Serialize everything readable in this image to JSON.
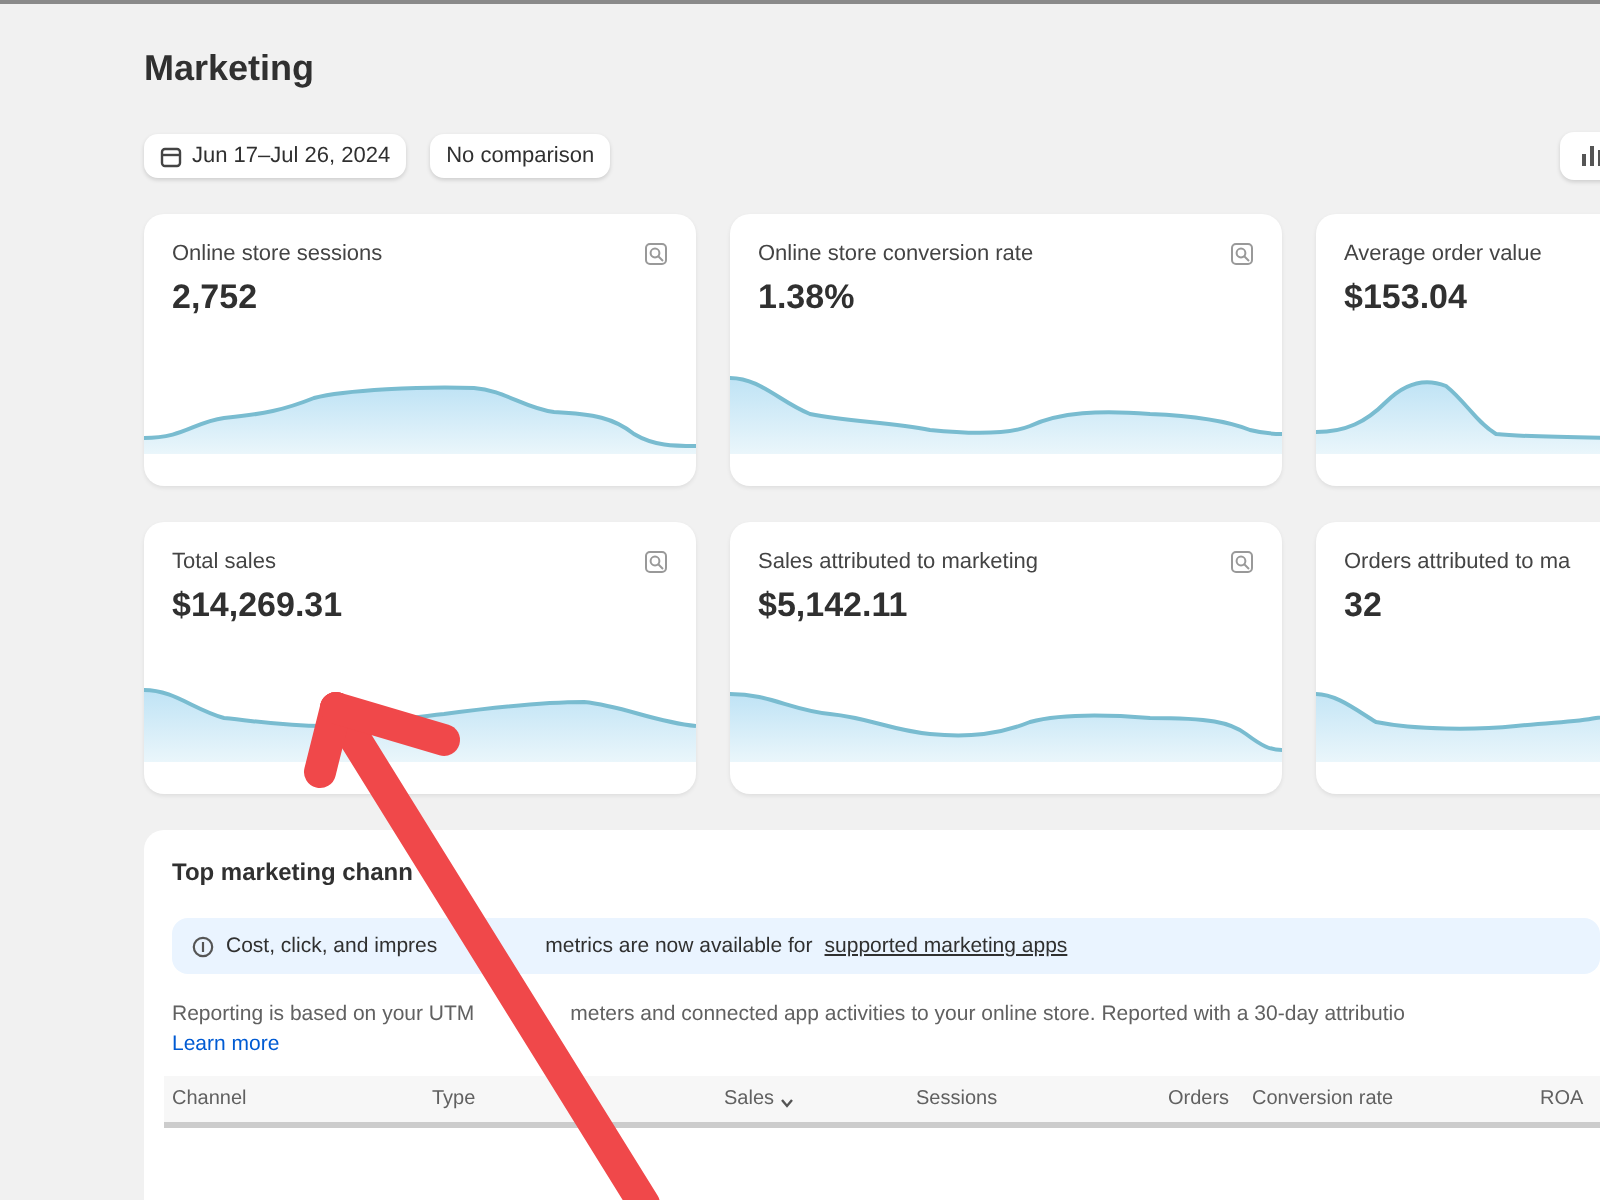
{
  "page": {
    "title": "Marketing"
  },
  "filters": [
    {
      "kind": "date",
      "label": "Jun 17–Jul 26, 2024"
    },
    {
      "kind": "plain",
      "label": "No comparison"
    }
  ],
  "metrics": [
    {
      "label": "Online store sessions",
      "value": "2,752"
    },
    {
      "label": "Online store conversion rate",
      "value": "1.38%"
    },
    {
      "label": "Average order value",
      "value": "$153.04"
    },
    {
      "label": "Total sales",
      "value": "$14,269.31"
    },
    {
      "label": "Sales attributed to marketing",
      "value": "$5,142.11"
    },
    {
      "label": "Orders attributed to ma",
      "value": "32"
    }
  ],
  "channels": {
    "title": "Top marketing chann",
    "notice": {
      "before": "Cost, click, and impres",
      "after": "metrics are now available for",
      "link": "supported marketing apps"
    },
    "description": {
      "before": "Reporting is based on your UTM",
      "after": "meters and connected app activities to your online store. Reported with a 30-day attributio"
    },
    "learn_more": "Learn more",
    "columns": [
      {
        "label": "Channel",
        "sorted": false
      },
      {
        "label": "Type",
        "sorted": false
      },
      {
        "label": "Sales",
        "sorted": true
      },
      {
        "label": "Sessions",
        "sorted": false
      },
      {
        "label": "Orders",
        "sorted": false
      },
      {
        "label": "Conversion rate",
        "sorted": false
      },
      {
        "label": "ROA",
        "sorted": false
      }
    ]
  }
}
